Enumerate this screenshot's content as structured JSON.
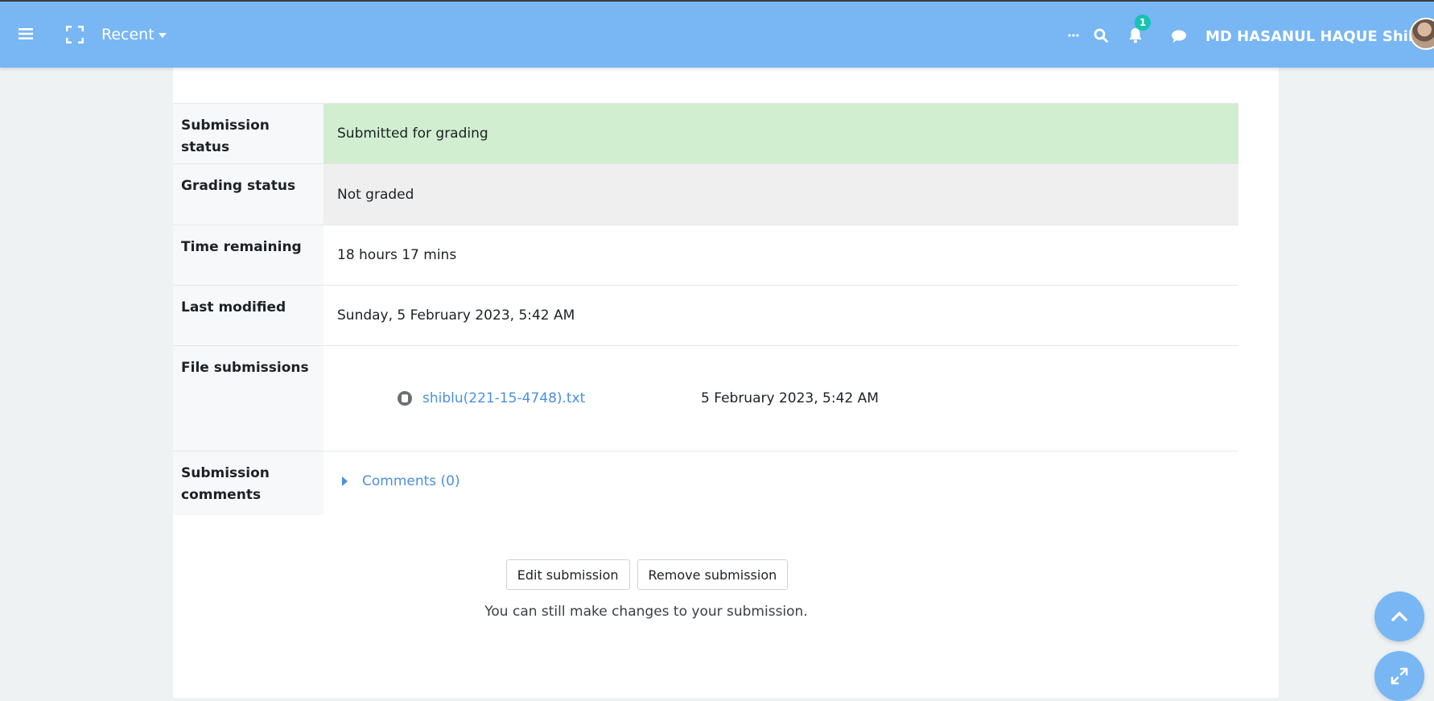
{
  "topbar": {
    "recent_label": "Recent",
    "notification_count": "1",
    "user_name": "MD HASANUL HAQUE Shiblu",
    "colors": {
      "bar": "#78b6f4",
      "badge": "#17c3b2"
    },
    "icons": [
      "menu-icon",
      "fullscreen-icon",
      "more-icon",
      "search-icon",
      "bell-icon",
      "chat-icon"
    ]
  },
  "submission": {
    "rows": [
      {
        "label": "Submission status",
        "value": "Submitted for grading"
      },
      {
        "label": "Grading status",
        "value": "Not graded"
      },
      {
        "label": "Time remaining",
        "value": "18 hours 17 mins"
      },
      {
        "label": "Last modified",
        "value": "Sunday, 5 February 2023, 5:42 AM"
      },
      {
        "label": "File submissions",
        "file_name": "shiblu(221-15-4748).txt",
        "file_date": "5 February 2023, 5:42 AM"
      },
      {
        "label": "Submission comments",
        "comments_link": "Comments (0)"
      }
    ],
    "colors": {
      "submitted": "#d1eed0",
      "not_graded": "#efefef",
      "link": "#4a90e2"
    }
  },
  "actions": {
    "edit_label": "Edit submission",
    "remove_label": "Remove submission",
    "hint": "You can still make changes to your submission."
  }
}
